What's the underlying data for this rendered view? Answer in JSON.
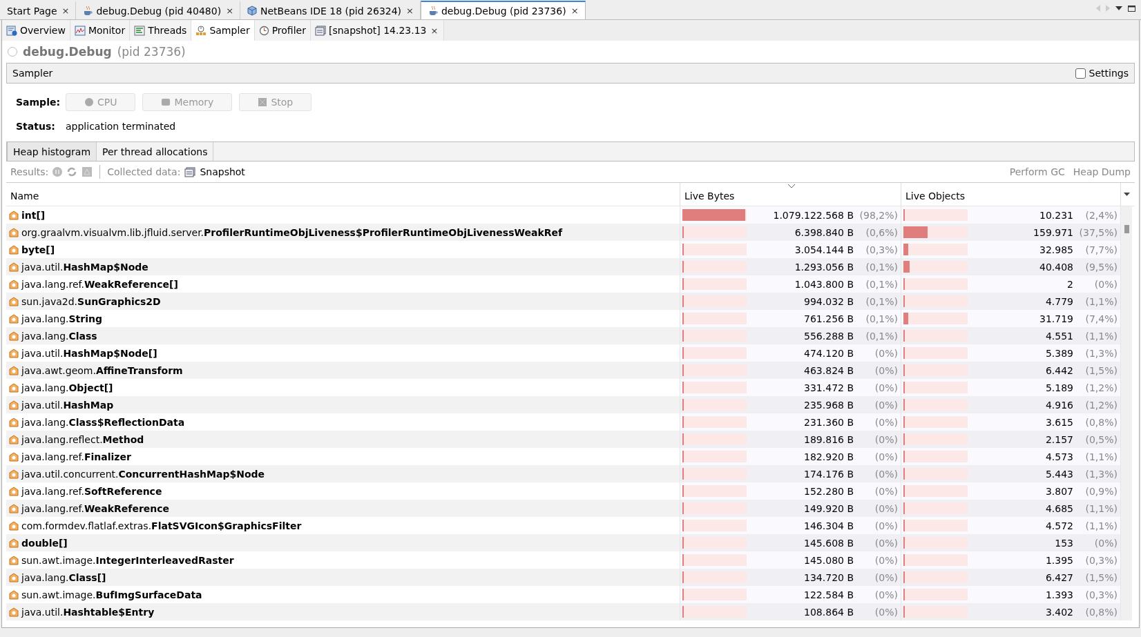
{
  "document_tabs": [
    {
      "label": "Start Page",
      "kind": "plain",
      "close": "×",
      "selected": false
    },
    {
      "label": "debug.Debug (pid 40480)",
      "kind": "java",
      "close": "×",
      "selected": false
    },
    {
      "label": "NetBeans IDE 18 (pid 26324)",
      "kind": "cube",
      "close": "×",
      "selected": false
    },
    {
      "label": "debug.Debug (pid 23736)",
      "kind": "java",
      "close": "×",
      "selected": true
    }
  ],
  "view_tabs": [
    {
      "label": "Overview",
      "kind": "overview",
      "selected": false
    },
    {
      "label": "Monitor",
      "kind": "monitor",
      "selected": false
    },
    {
      "label": "Threads",
      "kind": "threads",
      "selected": false
    },
    {
      "label": "Sampler",
      "kind": "sampler",
      "selected": true
    },
    {
      "label": "Profiler",
      "kind": "profiler",
      "selected": false
    },
    {
      "label": "[snapshot] 14.23.13",
      "kind": "snapshot",
      "close": "×",
      "selected": false
    }
  ],
  "app": {
    "name": "debug.Debug",
    "pid": "(pid 23736)"
  },
  "section": {
    "title": "Sampler",
    "settings": {
      "label": "Settings",
      "checked": false
    }
  },
  "sample": {
    "label": "Sample:",
    "buttons": [
      {
        "label": "CPU",
        "kind": "cpu",
        "disabled": true
      },
      {
        "label": "Memory",
        "kind": "memory",
        "disabled": true
      },
      {
        "label": "Stop",
        "kind": "stop",
        "disabled": true
      }
    ]
  },
  "status": {
    "label": "Status:",
    "value": "application terminated"
  },
  "result_tabs": [
    {
      "label": "Heap histogram",
      "selected": true
    },
    {
      "label": "Per thread allocations",
      "selected": false
    }
  ],
  "results_bar": {
    "label": "Results:",
    "collected_label": "Collected data:",
    "collected_value": "Snapshot",
    "actions": [
      "Perform GC",
      "Heap Dump"
    ]
  },
  "table": {
    "columns": [
      "Name",
      "Live Bytes",
      "Live Objects"
    ],
    "rows": [
      {
        "class": "int[]",
        "bytes": {
          "value": "1.079.122.568 B",
          "percent": "(98,2%)",
          "level": 0.982
        },
        "objects": {
          "value": "10.231",
          "percent": "(2,4%)",
          "level": 0.024
        }
      },
      {
        "package": "org.graalvm.visualvm.lib.jfluid.server.",
        "class": "ProfilerRuntimeObjLiveness$ProfilerRuntimeObjLivenessWeakRef",
        "bytes": {
          "value": "6.398.840 B",
          "percent": "(0,6%)",
          "level": 0.006
        },
        "objects": {
          "value": "159.971",
          "percent": "(37,5%)",
          "level": 0.375
        }
      },
      {
        "class": "byte[]",
        "bytes": {
          "value": "3.054.144 B",
          "percent": "(0,3%)",
          "level": 0.003
        },
        "objects": {
          "value": "32.985",
          "percent": "(7,7%)",
          "level": 0.077
        }
      },
      {
        "package": "java.util.",
        "class": "HashMap$Node",
        "bytes": {
          "value": "1.293.056 B",
          "percent": "(0,1%)",
          "level": 0.001
        },
        "objects": {
          "value": "40.408",
          "percent": "(9,5%)",
          "level": 0.095
        }
      },
      {
        "package": "java.lang.ref.",
        "class": "WeakReference[]",
        "bytes": {
          "value": "1.043.800 B",
          "percent": "(0,1%)",
          "level": 0.001
        },
        "objects": {
          "value": "2",
          "percent": "(0%)",
          "level": 0
        }
      },
      {
        "package": "sun.java2d.",
        "class": "SunGraphics2D",
        "bytes": {
          "value": "994.032 B",
          "percent": "(0,1%)",
          "level": 0.001
        },
        "objects": {
          "value": "4.779",
          "percent": "(1,1%)",
          "level": 0.011
        }
      },
      {
        "package": "java.lang.",
        "class": "String",
        "bytes": {
          "value": "761.256 B",
          "percent": "(0,1%)",
          "level": 0.001
        },
        "objects": {
          "value": "31.719",
          "percent": "(7,4%)",
          "level": 0.074
        }
      },
      {
        "package": "java.lang.",
        "class": "Class",
        "bytes": {
          "value": "556.288 B",
          "percent": "(0,1%)",
          "level": 0.001
        },
        "objects": {
          "value": "4.551",
          "percent": "(1,1%)",
          "level": 0.011
        }
      },
      {
        "package": "java.util.",
        "class": "HashMap$Node[]",
        "bytes": {
          "value": "474.120 B",
          "percent": "(0%)",
          "level": 0
        },
        "objects": {
          "value": "5.389",
          "percent": "(1,3%)",
          "level": 0.013
        }
      },
      {
        "package": "java.awt.geom.",
        "class": "AffineTransform",
        "bytes": {
          "value": "463.824 B",
          "percent": "(0%)",
          "level": 0
        },
        "objects": {
          "value": "6.442",
          "percent": "(1,5%)",
          "level": 0.015
        }
      },
      {
        "package": "java.lang.",
        "class": "Object[]",
        "bytes": {
          "value": "331.472 B",
          "percent": "(0%)",
          "level": 0
        },
        "objects": {
          "value": "5.189",
          "percent": "(1,2%)",
          "level": 0.012
        }
      },
      {
        "package": "java.util.",
        "class": "HashMap",
        "bytes": {
          "value": "235.968 B",
          "percent": "(0%)",
          "level": 0
        },
        "objects": {
          "value": "4.916",
          "percent": "(1,2%)",
          "level": 0.012
        }
      },
      {
        "package": "java.lang.",
        "class": "Class$ReflectionData",
        "bytes": {
          "value": "231.360 B",
          "percent": "(0%)",
          "level": 0
        },
        "objects": {
          "value": "3.615",
          "percent": "(0,8%)",
          "level": 0.008
        }
      },
      {
        "package": "java.lang.reflect.",
        "class": "Method",
        "bytes": {
          "value": "189.816 B",
          "percent": "(0%)",
          "level": 0
        },
        "objects": {
          "value": "2.157",
          "percent": "(0,5%)",
          "level": 0.005
        }
      },
      {
        "package": "java.lang.ref.",
        "class": "Finalizer",
        "bytes": {
          "value": "182.920 B",
          "percent": "(0%)",
          "level": 0
        },
        "objects": {
          "value": "4.573",
          "percent": "(1,1%)",
          "level": 0.011
        }
      },
      {
        "package": "java.util.concurrent.",
        "class": "ConcurrentHashMap$Node",
        "bytes": {
          "value": "174.176 B",
          "percent": "(0%)",
          "level": 0
        },
        "objects": {
          "value": "5.443",
          "percent": "(1,3%)",
          "level": 0.013
        }
      },
      {
        "package": "java.lang.ref.",
        "class": "SoftReference",
        "bytes": {
          "value": "152.280 B",
          "percent": "(0%)",
          "level": 0
        },
        "objects": {
          "value": "3.807",
          "percent": "(0,9%)",
          "level": 0.009
        }
      },
      {
        "package": "java.lang.ref.",
        "class": "WeakReference",
        "bytes": {
          "value": "149.920 B",
          "percent": "(0%)",
          "level": 0
        },
        "objects": {
          "value": "4.685",
          "percent": "(1,1%)",
          "level": 0.011
        }
      },
      {
        "package": "com.formdev.flatlaf.extras.",
        "class": "FlatSVGIcon$GraphicsFilter",
        "bytes": {
          "value": "146.304 B",
          "percent": "(0%)",
          "level": 0
        },
        "objects": {
          "value": "4.572",
          "percent": "(1,1%)",
          "level": 0.011
        }
      },
      {
        "class": "double[]",
        "bytes": {
          "value": "145.608 B",
          "percent": "(0%)",
          "level": 0
        },
        "objects": {
          "value": "153",
          "percent": "(0%)",
          "level": 0
        }
      },
      {
        "package": "sun.awt.image.",
        "class": "IntegerInterleavedRaster",
        "bytes": {
          "value": "145.080 B",
          "percent": "(0%)",
          "level": 0
        },
        "objects": {
          "value": "1.395",
          "percent": "(0,3%)",
          "level": 0.003
        }
      },
      {
        "package": "java.lang.",
        "class": "Class[]",
        "bytes": {
          "value": "134.720 B",
          "percent": "(0%)",
          "level": 0
        },
        "objects": {
          "value": "6.427",
          "percent": "(1,5%)",
          "level": 0.015
        }
      },
      {
        "package": "sun.awt.image.",
        "class": "BufImgSurfaceData",
        "bytes": {
          "value": "122.584 B",
          "percent": "(0%)",
          "level": 0
        },
        "objects": {
          "value": "1.393",
          "percent": "(0,3%)",
          "level": 0.003
        }
      },
      {
        "package": "java.util.",
        "class": "Hashtable$Entry",
        "bytes": {
          "value": "108.864 B",
          "percent": "(0%)",
          "level": 0
        },
        "objects": {
          "value": "3.402",
          "percent": "(0,8%)",
          "level": 0.008
        }
      }
    ]
  }
}
